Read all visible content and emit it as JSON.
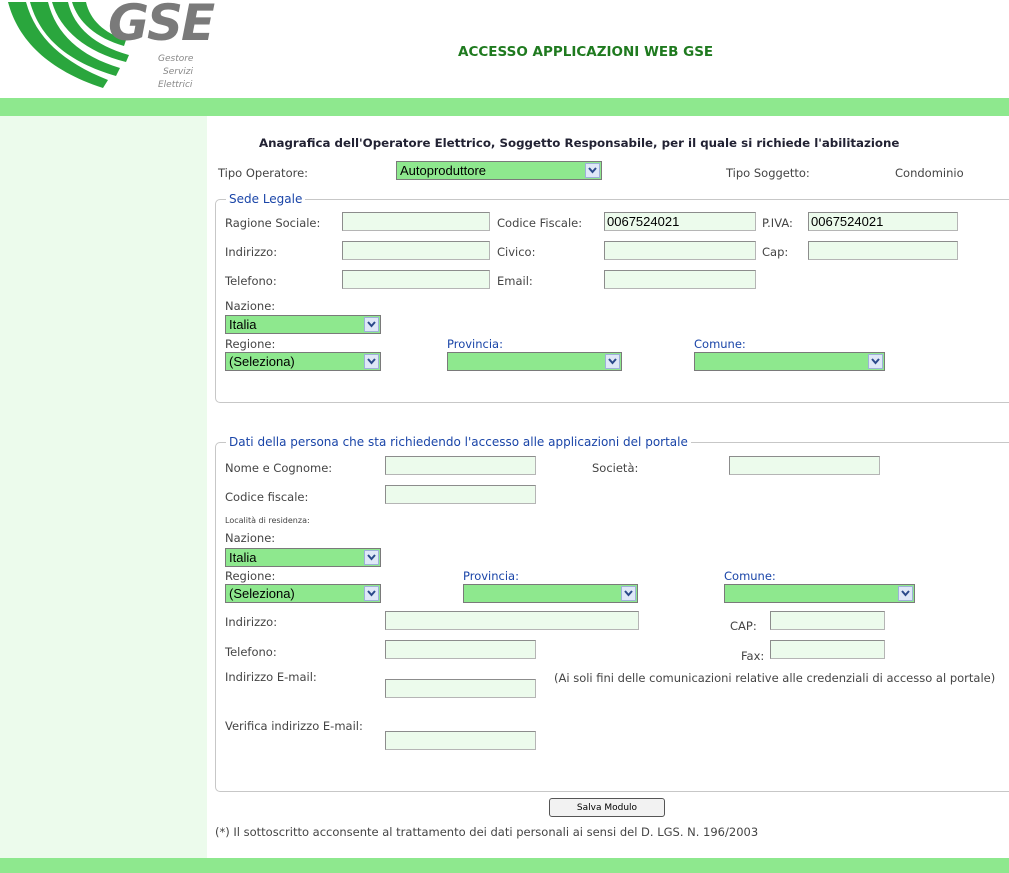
{
  "header": {
    "logo_text": "GSE",
    "logo_sub": [
      "Gestore",
      "Servizi",
      "Elettrici"
    ],
    "title": "ACCESSO APPLICAZIONI WEB GSE"
  },
  "colors": {
    "bar": "#8ee88e",
    "accent_text": "#1a45a8",
    "title_green": "#1f7a1f",
    "logo_green": "#2aa63d"
  },
  "form": {
    "heading": "Anagrafica dell'Operatore Elettrico, Soggetto Responsabile, per il quale si richiede l'abilitazione",
    "tipo_operatore_label": "Tipo Operatore:",
    "tipo_operatore_value": "Autoproduttore",
    "tipo_soggetto_label": "Tipo Soggetto:",
    "tipo_soggetto_value": "Condominio"
  },
  "sede_legale": {
    "legend": "Sede Legale",
    "ragione_sociale_label": "Ragione Sociale:",
    "ragione_sociale_value": "",
    "codice_fiscale_label": "Codice Fiscale:",
    "codice_fiscale_value": "0067524021",
    "piva_label": "P.IVA:",
    "piva_value": "0067524021",
    "indirizzo_label": "Indirizzo:",
    "civico_label": "Civico:",
    "cap_label": "Cap:",
    "telefono_label": "Telefono:",
    "email_label": "Email:",
    "nazione_label": "Nazione:",
    "nazione_value": "Italia",
    "regione_label": "Regione:",
    "regione_value": "(Seleziona)",
    "provincia_label": "Provincia:",
    "provincia_value": "",
    "comune_label": "Comune:",
    "comune_value": ""
  },
  "persona": {
    "legend": "Dati della persona che sta richiedendo l'accesso alle applicazioni del portale",
    "nome_label": "Nome e Cognome:",
    "societa_label": "Società:",
    "codice_fiscale_label": "Codice fiscale:",
    "localita_label": "Località di residenza:",
    "nazione_label": "Nazione:",
    "nazione_value": "Italia",
    "regione_label": "Regione:",
    "regione_value": "(Seleziona)",
    "provincia_label": "Provincia:",
    "provincia_value": "",
    "comune_label": "Comune:",
    "comune_value": "",
    "indirizzo_label": "Indirizzo:",
    "cap_label": "CAP:",
    "telefono_label": "Telefono:",
    "fax_label": "Fax:",
    "email_label": "Indirizzo E-mail:",
    "email_note": "(Ai soli fini delle comunicazioni relative alle credenziali di accesso al portale)",
    "verifica_label": "Verifica indirizzo E-mail:"
  },
  "actions": {
    "save_label": "Salva Modulo"
  },
  "footer": {
    "privacy_note": "(*) Il sottoscritto acconsente al trattamento dei dati personali ai sensi del D. LGS. N. 196/2003"
  }
}
